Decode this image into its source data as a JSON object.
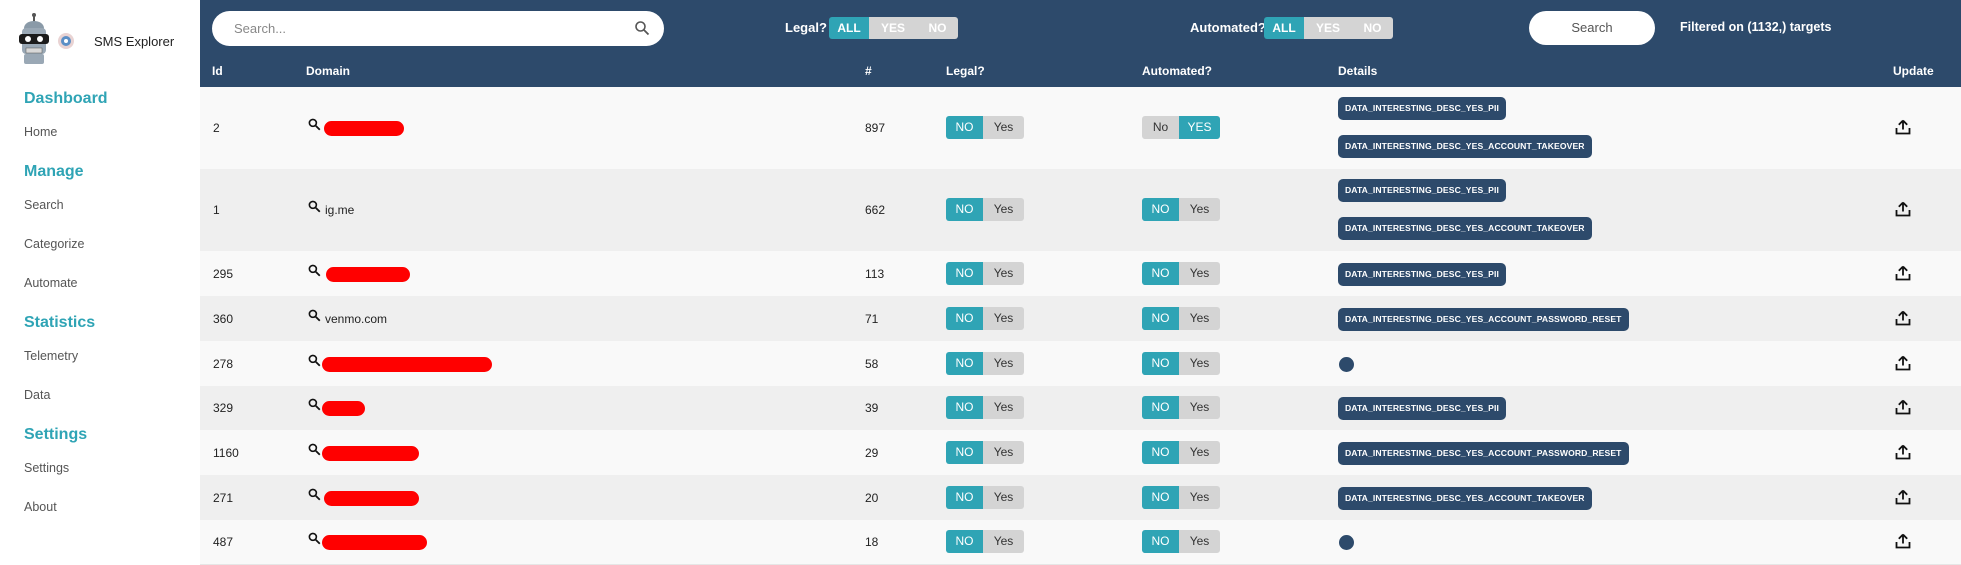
{
  "sidebar": {
    "app_name": "SMS Explorer",
    "sections": [
      {
        "title": "Dashboard",
        "items": [
          "Home"
        ]
      },
      {
        "title": "Manage",
        "items": [
          "Search",
          "Categorize",
          "Automate"
        ]
      },
      {
        "title": "Statistics",
        "items": [
          "Telemetry",
          "Data"
        ]
      },
      {
        "title": "Settings",
        "items": [
          "Settings",
          "About"
        ]
      }
    ]
  },
  "topbar": {
    "search_placeholder": "Search...",
    "legal_label": "Legal?",
    "legal_options": [
      "ALL",
      "YES",
      "NO"
    ],
    "legal_selected": "ALL",
    "automated_label": "Automated?",
    "automated_options": [
      "ALL",
      "YES",
      "NO"
    ],
    "automated_selected": "ALL",
    "search_button": "Search",
    "filtered_text": "Filtered on (1132,) targets"
  },
  "table": {
    "headers": [
      "Id",
      "Domain",
      "#",
      "Legal?",
      "Automated?",
      "Details",
      "Update"
    ],
    "toggle_labels": {
      "legal": [
        "NO",
        "Yes"
      ],
      "auto_no": [
        "NO",
        "Yes"
      ],
      "auto_yes": [
        "No",
        "YES"
      ]
    },
    "rows": [
      {
        "id": "2",
        "domain": "",
        "redacted": true,
        "count": "897",
        "legal": "NO",
        "automated": "YES",
        "details": [
          "DATA_INTERESTING_DESC_YES_PII",
          "DATA_INTERESTING_DESC_YES_ACCOUNT_TAKEOVER"
        ]
      },
      {
        "id": "1",
        "domain": "ig.me",
        "redacted": false,
        "count": "662",
        "legal": "NO",
        "automated": "NO",
        "details": [
          "DATA_INTERESTING_DESC_YES_PII",
          "DATA_INTERESTING_DESC_YES_ACCOUNT_TAKEOVER"
        ]
      },
      {
        "id": "295",
        "domain": "",
        "redacted": true,
        "count": "113",
        "legal": "NO",
        "automated": "NO",
        "details": [
          "DATA_INTERESTING_DESC_YES_PII"
        ]
      },
      {
        "id": "360",
        "domain": "venmo.com",
        "redacted": false,
        "count": "71",
        "legal": "NO",
        "automated": "NO",
        "details": [
          "DATA_INTERESTING_DESC_YES_ACCOUNT_PASSWORD_RESET"
        ]
      },
      {
        "id": "278",
        "domain": "",
        "redacted": true,
        "count": "58",
        "legal": "NO",
        "automated": "NO",
        "details": []
      },
      {
        "id": "329",
        "domain": "",
        "redacted": true,
        "count": "39",
        "legal": "NO",
        "automated": "NO",
        "details": [
          "DATA_INTERESTING_DESC_YES_PII"
        ]
      },
      {
        "id": "1160",
        "domain": "",
        "redacted": true,
        "count": "29",
        "legal": "NO",
        "automated": "NO",
        "details": [
          "DATA_INTERESTING_DESC_YES_ACCOUNT_PASSWORD_RESET"
        ]
      },
      {
        "id": "271",
        "domain": "",
        "redacted": true,
        "count": "20",
        "legal": "NO",
        "automated": "NO",
        "details": [
          "DATA_INTERESTING_DESC_YES_ACCOUNT_TAKEOVER"
        ]
      },
      {
        "id": "487",
        "domain": "",
        "redacted": true,
        "count": "18",
        "legal": "NO",
        "automated": "NO",
        "details": []
      }
    ]
  },
  "colors": {
    "header_bg": "#2d4a6b",
    "accent": "#2fa4b5",
    "redaction": "#ff0000"
  }
}
